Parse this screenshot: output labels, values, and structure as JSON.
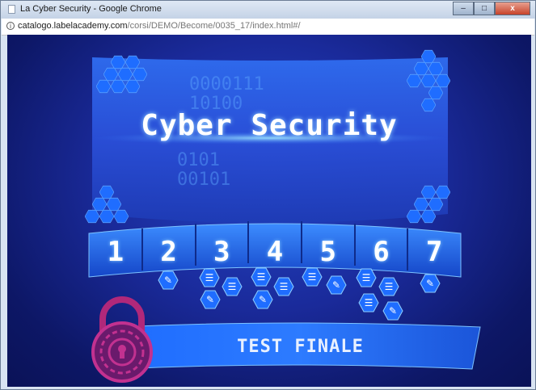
{
  "window": {
    "title": "La Cyber Security - Google Chrome",
    "minimize_label": "–",
    "maximize_label": "□",
    "close_label": "x"
  },
  "address_bar": {
    "host": "catalogo.labelacademy.com",
    "path": "/corsi/DEMO/Become/0035_17/index.html#/"
  },
  "course": {
    "title": "Cyber Security",
    "binary_text": [
      "0000111",
      "10100",
      "0101",
      "00101"
    ]
  },
  "modules": [
    {
      "number": "1"
    },
    {
      "number": "2"
    },
    {
      "number": "3"
    },
    {
      "number": "4"
    },
    {
      "number": "5"
    },
    {
      "number": "6"
    },
    {
      "number": "7"
    }
  ],
  "resources": [
    {
      "module": "2",
      "icon": "pencil-icon"
    },
    {
      "module": "3",
      "icon": "stack-icon"
    },
    {
      "module": "3",
      "icon": "stack-icon"
    },
    {
      "module": "3",
      "icon": "pencil-icon"
    },
    {
      "module": "4",
      "icon": "stack-icon"
    },
    {
      "module": "4",
      "icon": "stack-icon"
    },
    {
      "module": "4",
      "icon": "pencil-icon"
    },
    {
      "module": "5",
      "icon": "stack-icon"
    },
    {
      "module": "5",
      "icon": "pencil-icon"
    },
    {
      "module": "6",
      "icon": "stack-icon"
    },
    {
      "module": "6",
      "icon": "stack-icon"
    },
    {
      "module": "6",
      "icon": "stack-icon"
    },
    {
      "module": "6",
      "icon": "pencil-icon"
    },
    {
      "module": "7",
      "icon": "pencil-icon"
    }
  ],
  "final_test": {
    "label": "TEST FINALE",
    "icon": "padlock-icon"
  },
  "colors": {
    "background": "#1a2a9a",
    "accent": "#2f8cff",
    "hexagon": "#1f6dff",
    "padlock": "#b0287a"
  }
}
